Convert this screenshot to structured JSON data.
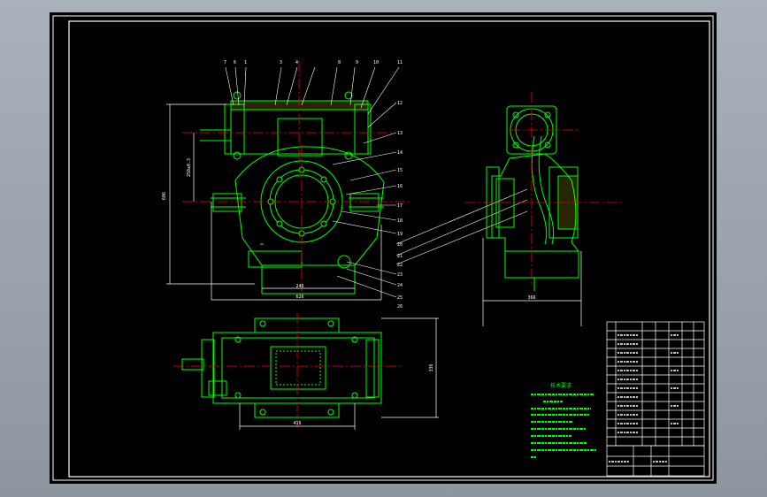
{
  "drawing": {
    "background_color": "#000000",
    "frame_color": "#ffffff",
    "part_color": "#00ff00",
    "center_line_color": "#ff0000",
    "dimension_color": "#ffffff",
    "hatch_color": "#ffff00"
  },
  "leaders_left": [
    "7",
    "6",
    "1",
    "3",
    "4",
    "8",
    "9",
    "10",
    "11"
  ],
  "leaders_right": [
    "12",
    "13",
    "14",
    "15",
    "16",
    "17",
    "18",
    "19",
    "20",
    "21",
    "22",
    "23",
    "24",
    "25",
    "26"
  ],
  "dimensions": {
    "front_height": "606",
    "center_height": "250±0.3",
    "base_width": "246",
    "overall_width": "626",
    "side_width": "366",
    "top_width": "416",
    "top_depth": "336"
  },
  "notes": {
    "title": "技术要求"
  }
}
